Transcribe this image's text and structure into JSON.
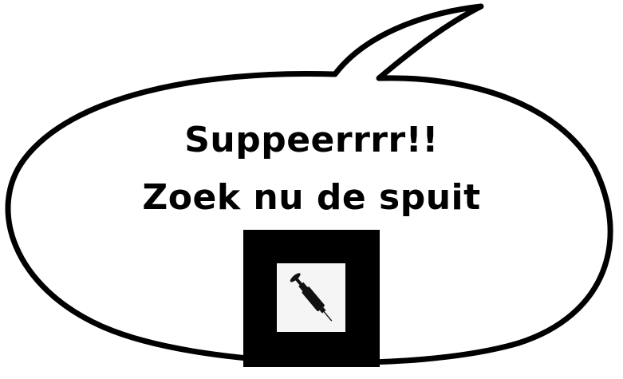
{
  "bubble": {
    "line1": "Suppeerrrr!!",
    "line2": "Zoek nu de spuit"
  },
  "marker": {
    "icon": "syringe-icon"
  }
}
